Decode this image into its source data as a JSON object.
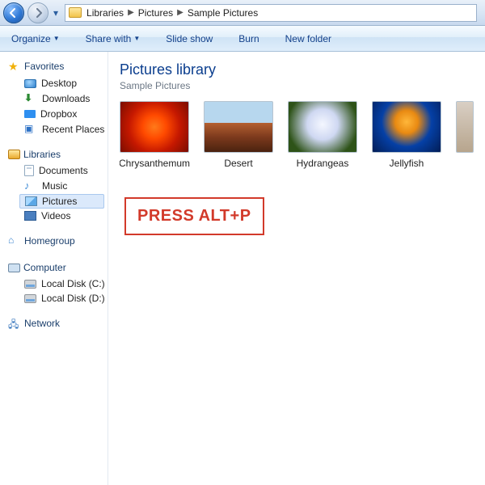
{
  "breadcrumb": {
    "parts": [
      "Libraries",
      "Pictures",
      "Sample Pictures"
    ]
  },
  "toolbar": {
    "organize": "Organize",
    "share": "Share with",
    "slideshow": "Slide show",
    "burn": "Burn",
    "newfolder": "New folder"
  },
  "nav": {
    "favorites": {
      "label": "Favorites",
      "items": [
        "Desktop",
        "Downloads",
        "Dropbox",
        "Recent Places"
      ]
    },
    "libraries": {
      "label": "Libraries",
      "items": [
        "Documents",
        "Music",
        "Pictures",
        "Videos"
      ],
      "selected": "Pictures"
    },
    "homegroup": {
      "label": "Homegroup"
    },
    "computer": {
      "label": "Computer",
      "items": [
        "Local Disk (C:)",
        "Local Disk (D:)"
      ]
    },
    "network": {
      "label": "Network"
    }
  },
  "library": {
    "title": "Pictures library",
    "subtitle": "Sample Pictures"
  },
  "pictures": [
    {
      "name": "Chrysanthemum"
    },
    {
      "name": "Desert"
    },
    {
      "name": "Hydrangeas"
    },
    {
      "name": "Jellyfish"
    }
  ],
  "annotation": "PRESS ALT+P"
}
